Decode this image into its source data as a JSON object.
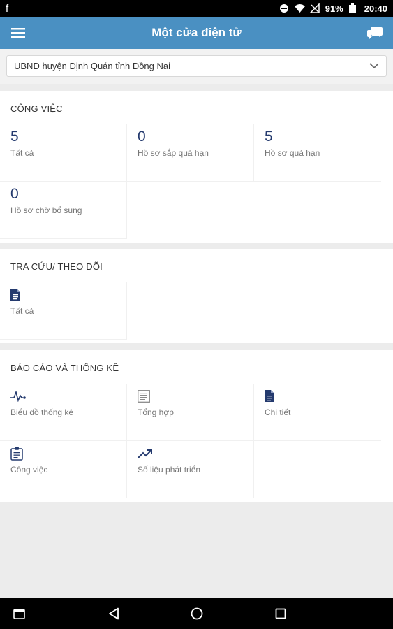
{
  "status_bar": {
    "battery": "91%",
    "time": "20:40",
    "app_letter": "f"
  },
  "app_bar": {
    "title": "Một cửa điện tử"
  },
  "org_selector": {
    "value": "UBND huyện Định Quán tỉnh Đồng Nai"
  },
  "work": {
    "title": "CÔNG VIỆC",
    "items": [
      {
        "count": "5",
        "label": "Tất cả"
      },
      {
        "count": "0",
        "label": "Hồ sơ sắp quá hạn"
      },
      {
        "count": "5",
        "label": "Hồ sơ quá hạn"
      },
      {
        "count": "0",
        "label": "Hồ sơ chờ bổ sung"
      }
    ]
  },
  "lookup": {
    "title": "TRA CỨU/ THEO DÕI",
    "items": [
      {
        "label": "Tất cả",
        "icon": "document-icon"
      }
    ]
  },
  "reports": {
    "title": "BÁO CÁO VÀ THỐNG KÊ",
    "items": [
      {
        "label": "Biểu đồ thống kê",
        "icon": "pulse-chart-icon"
      },
      {
        "label": "Tổng hợp",
        "icon": "list-doc-icon"
      },
      {
        "label": "Chi tiết",
        "icon": "document-icon"
      },
      {
        "label": "Công việc",
        "icon": "clipboard-icon"
      },
      {
        "label": "Số liệu phát triển",
        "icon": "trending-up-icon"
      }
    ]
  },
  "colors": {
    "app_bar": "#4a90c2",
    "count_text": "#243a6e"
  }
}
